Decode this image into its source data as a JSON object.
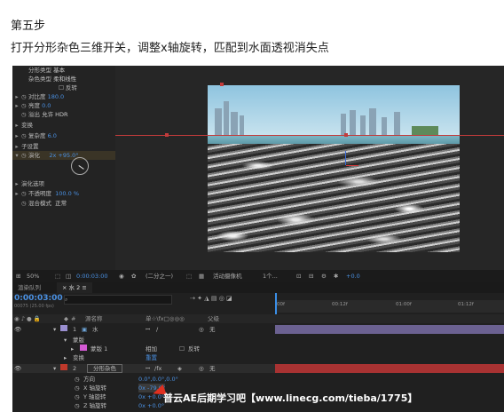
{
  "tutorial": {
    "step_title": "第五步",
    "step_desc": "打开分形杂色三维开关，调整x轴旋转，匹配到水面透视消失点"
  },
  "effect_controls": {
    "rows": [
      {
        "label": "分形类型",
        "value": "基本"
      },
      {
        "label": "杂色类型",
        "value": "柔和线性"
      },
      {
        "label": "反转",
        "value": ""
      },
      {
        "label": "对比度",
        "value": "180.0"
      },
      {
        "label": "亮度",
        "value": "0.0"
      },
      {
        "label": "溢出",
        "value": "允许 HDR"
      },
      {
        "label": "变换",
        "value": ""
      },
      {
        "label": "复杂度",
        "value": "6.0"
      },
      {
        "label": "子设置",
        "value": ""
      },
      {
        "label": "演化",
        "value": "2x +95.0°"
      },
      {
        "label": "演化选项",
        "value": ""
      },
      {
        "label": "不透明度",
        "value": "100.0 %"
      },
      {
        "label": "混合模式",
        "value": "正常"
      }
    ]
  },
  "viewer_toolbar": {
    "zoom": "50%",
    "timecode": "0:00:03:00",
    "resolution": "(二分之一)",
    "camera": "活动摄像机",
    "views": "1个...",
    "exposure": "+0.0"
  },
  "timeline": {
    "tabs": [
      "渲染队列",
      "水 2"
    ],
    "timecode": "0:00:03:00",
    "fps": "00075 (25.00 fps)",
    "search_placeholder": "",
    "ruler": [
      "00f",
      "00:12f",
      "01:00f",
      "01:12f"
    ],
    "headers": {
      "source": "源名称",
      "switches": "单☆\\fx□◎◎◎",
      "parent": "父级"
    },
    "layers": [
      {
        "num": "1",
        "name": "水",
        "parent": "无",
        "color": "#9a8fd0"
      },
      {
        "sub": "蒙版"
      },
      {
        "sub": "蒙版 1",
        "mode": "相加",
        "invert": "反转"
      },
      {
        "sub": "变换",
        "value": "重置"
      },
      {
        "num": "2",
        "name": "分形杂色",
        "parent": "无",
        "color": "#c0392b"
      },
      {
        "prop": "方向",
        "value": "0.0°,0.0°,0.0°"
      },
      {
        "prop": "X 轴旋转",
        "value": "0x -79.0°"
      },
      {
        "prop": "Y 轴旋转",
        "value": "0x +0.0°"
      },
      {
        "prop": "Z 轴旋转",
        "value": "0x +0.0°"
      }
    ]
  },
  "watermark": "普云AE后期学习吧【www.linecg.com/tieba/1775】",
  "colors": {
    "accent": "#4a90e2",
    "track_red": "#c23b3b",
    "layer1_purple": "#9a8fd0"
  }
}
